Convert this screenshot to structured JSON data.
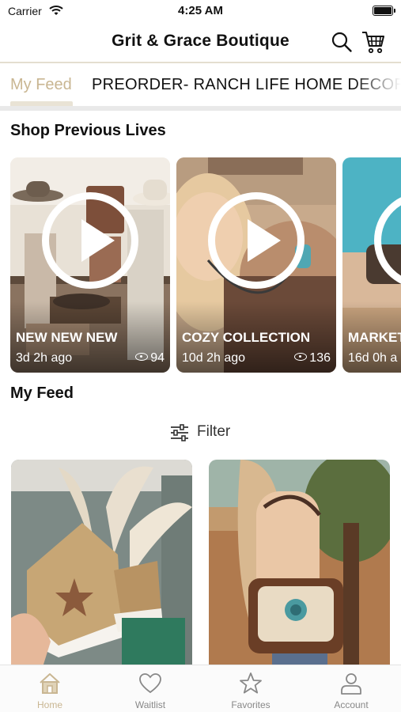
{
  "status_bar": {
    "carrier": "Carrier",
    "time": "4:25 AM"
  },
  "header": {
    "title": "Grit & Grace Boutique"
  },
  "tabs": [
    {
      "label": "My Feed",
      "active": true
    },
    {
      "label": "PREORDER- RANCH LIFE HOME DECOR",
      "active": false
    }
  ],
  "sections": {
    "lives_title": "Shop Previous Lives",
    "feed_title": "My Feed"
  },
  "lives": [
    {
      "name": "NEW NEW NEW",
      "ago": "3d 2h ago",
      "views": "94"
    },
    {
      "name": "COZY COLLECTION",
      "ago": "10d 2h ago",
      "views": "136"
    },
    {
      "name": "MARKET",
      "ago": "16d 0h a",
      "views": ""
    }
  ],
  "filter": {
    "label": "Filter"
  },
  "bottom_nav": [
    {
      "label": "Home",
      "icon": "home-icon",
      "active": true
    },
    {
      "label": "Waitlist",
      "icon": "heart-icon",
      "active": false
    },
    {
      "label": "Favorites",
      "icon": "star-icon",
      "active": false
    },
    {
      "label": "Account",
      "icon": "person-icon",
      "active": false
    }
  ],
  "colors": {
    "accent": "#c9b692",
    "accent_light": "#e9e3d5",
    "inactive": "#888888"
  }
}
